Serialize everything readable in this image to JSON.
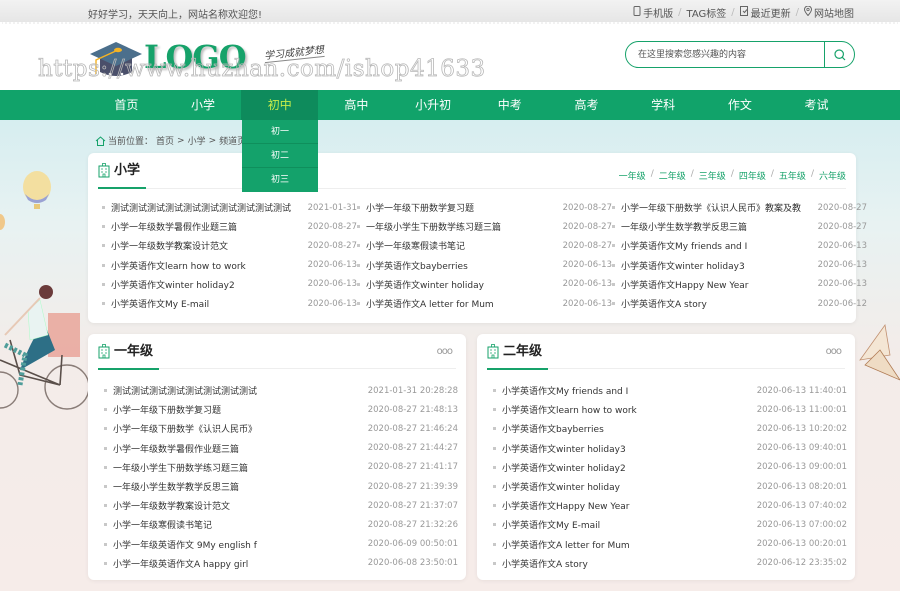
{
  "topbar": {
    "welcome": "好好学习，天天向上，网站名称欢迎您!",
    "links": [
      {
        "icon": "mobile-icon",
        "label": "手机版"
      },
      {
        "icon": "",
        "label": "TAG标签"
      },
      {
        "icon": "update-icon",
        "label": "最近更新"
      },
      {
        "icon": "location-pin-icon",
        "label": "网站地图"
      }
    ],
    "separator": "/"
  },
  "header": {
    "logo_text": "LOGO",
    "slogan": "学习成就梦想",
    "watermark": "https://www.huzhan.com/ishop41633",
    "search": {
      "placeholder": "在这里搜索您感兴趣的内容",
      "value": ""
    }
  },
  "colors": {
    "brand": "#11a36a",
    "active_nav_bg": "#0e8b5c",
    "active_nav_text": "#c5ec4a"
  },
  "nav": {
    "items": [
      "首页",
      "小学",
      "初中",
      "高中",
      "小升初",
      "中考",
      "高考",
      "学科",
      "作文",
      "考试"
    ],
    "active_index": 2,
    "dropdown": [
      "初一",
      "初二",
      "初三"
    ]
  },
  "breadcrumb": {
    "prefix": "当前位置：",
    "items": [
      "首页",
      "小学",
      "频道页"
    ],
    "separator": ">"
  },
  "primary_section": {
    "title": "小学",
    "grades": [
      "一年级",
      "二年级",
      "三年级",
      "四年级",
      "五年级",
      "六年级"
    ],
    "columns": [
      [
        {
          "title": "测试测试测试测试测试测试测试测试测试测试",
          "date": "2021-01-31"
        },
        {
          "title": "小学一年级数学暑假作业题三篇",
          "date": "2020-08-27"
        },
        {
          "title": "小学一年级数学教案设计范文",
          "date": "2020-08-27"
        },
        {
          "title": "小学英语作文learn how to work",
          "date": "2020-06-13"
        },
        {
          "title": "小学英语作文winter holiday2",
          "date": "2020-06-13"
        },
        {
          "title": "小学英语作文My E-mail",
          "date": "2020-06-13"
        }
      ],
      [
        {
          "title": "小学一年级下册数学复习题",
          "date": "2020-08-27"
        },
        {
          "title": "一年级小学生下册数学练习题三篇",
          "date": "2020-08-27"
        },
        {
          "title": "小学一年级寒假读书笔记",
          "date": "2020-08-27"
        },
        {
          "title": "小学英语作文bayberries",
          "date": "2020-06-13"
        },
        {
          "title": "小学英语作文winter holiday",
          "date": "2020-06-13"
        },
        {
          "title": "小学英语作文A letter for Mum",
          "date": "2020-06-13"
        }
      ],
      [
        {
          "title": "小学一年级下册数学《认识人民币》教案及教",
          "date": "2020-08-27"
        },
        {
          "title": "一年级小学生数学教学反思三篇",
          "date": "2020-08-27"
        },
        {
          "title": "小学英语作文My friends and I",
          "date": "2020-06-13"
        },
        {
          "title": "小学英语作文winter holiday3",
          "date": "2020-06-13"
        },
        {
          "title": "小学英语作文Happy New Year",
          "date": "2020-06-13"
        },
        {
          "title": "小学英语作文A story",
          "date": "2020-06-12"
        }
      ]
    ]
  },
  "grade_sections": [
    {
      "title": "一年级",
      "more": "ooo",
      "items": [
        {
          "title": "测试测试测试测试测试测试测试测试",
          "date": "2021-01-31 20:28:28"
        },
        {
          "title": "小学一年级下册数学复习题",
          "date": "2020-08-27 21:48:13"
        },
        {
          "title": "小学一年级下册数学《认识人民币》",
          "date": "2020-08-27 21:46:24"
        },
        {
          "title": "小学一年级数学暑假作业题三篇",
          "date": "2020-08-27 21:44:27"
        },
        {
          "title": "一年级小学生下册数学练习题三篇",
          "date": "2020-08-27 21:41:17"
        },
        {
          "title": "一年级小学生数学教学反思三篇",
          "date": "2020-08-27 21:39:39"
        },
        {
          "title": "小学一年级数学教案设计范文",
          "date": "2020-08-27 21:37:07"
        },
        {
          "title": "小学一年级寒假读书笔记",
          "date": "2020-08-27 21:32:26"
        },
        {
          "title": "小学一年级英语作文 9My english f",
          "date": "2020-06-09 00:50:01"
        },
        {
          "title": "小学一年级英语作文A happy girl",
          "date": "2020-06-08 23:50:01"
        }
      ]
    },
    {
      "title": "二年级",
      "more": "ooo",
      "items": [
        {
          "title": "小学英语作文My friends and I",
          "date": "2020-06-13 11:40:01"
        },
        {
          "title": "小学英语作文learn how to work",
          "date": "2020-06-13 11:00:01"
        },
        {
          "title": "小学英语作文bayberries",
          "date": "2020-06-13 10:20:02"
        },
        {
          "title": "小学英语作文winter holiday3",
          "date": "2020-06-13 09:40:01"
        },
        {
          "title": "小学英语作文winter holiday2",
          "date": "2020-06-13 09:00:01"
        },
        {
          "title": "小学英语作文winter holiday",
          "date": "2020-06-13 08:20:01"
        },
        {
          "title": "小学英语作文Happy New Year",
          "date": "2020-06-13 07:40:02"
        },
        {
          "title": "小学英语作文My E-mail",
          "date": "2020-06-13 07:00:02"
        },
        {
          "title": "小学英语作文A letter for Mum",
          "date": "2020-06-13 00:20:01"
        },
        {
          "title": "小学英语作文A story",
          "date": "2020-06-12 23:35:02"
        }
      ]
    }
  ]
}
